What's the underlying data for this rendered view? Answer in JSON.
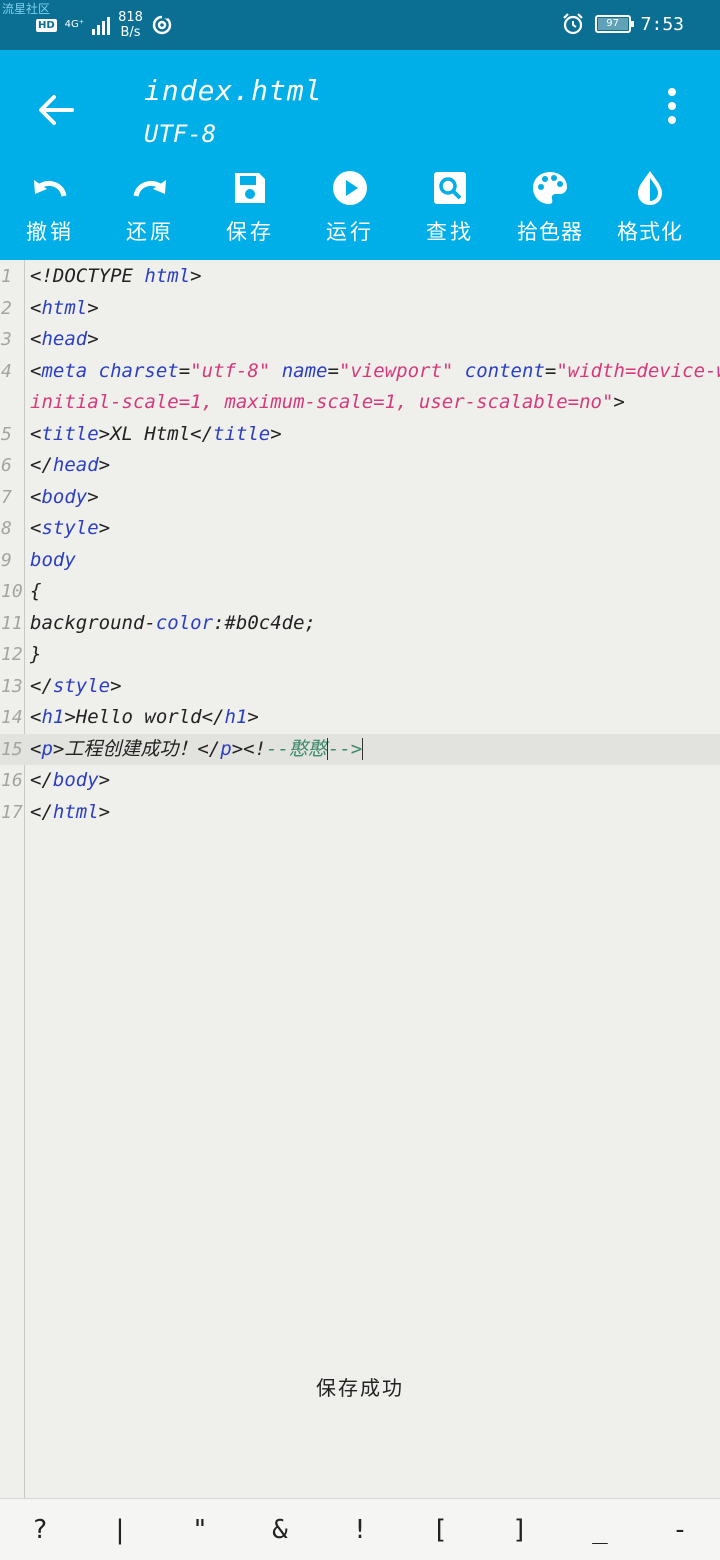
{
  "status_bar": {
    "watermark": "流星社区",
    "hd": "HD",
    "network": "4G⁺",
    "speed_value": "818",
    "speed_unit": "B/s",
    "battery": "97",
    "time": "7:53",
    "icons": [
      "hd-icon",
      "signal-icon",
      "nfc-icon",
      "alarm-icon",
      "battery-icon"
    ]
  },
  "app_bar": {
    "title": "index.html",
    "encoding": "UTF-8",
    "accent_color": "#00aee8"
  },
  "toolbar": {
    "undo": "撤销",
    "redo": "还原",
    "save": "保存",
    "run": "运行",
    "find": "查找",
    "color_picker": "拾色器",
    "format": "格式化"
  },
  "editor": {
    "lines": [
      {
        "n": "1",
        "parts": [
          "<!DOCTYPE ",
          "html",
          ">"
        ]
      },
      {
        "n": "2",
        "parts": [
          "<",
          "html",
          ">"
        ]
      },
      {
        "n": "3",
        "parts": [
          "<",
          "head",
          ">"
        ]
      },
      {
        "n": "4",
        "parts": [
          "<",
          "meta",
          " ",
          "charset",
          "=",
          "\"utf-8\"",
          " ",
          "name",
          "=",
          "\"viewport\"",
          " ",
          "content",
          "=",
          "\"width=device-width,"
        ]
      },
      {
        "n": "",
        "parts": [
          "initial-scale=1, maximum-scale=1, user-scalable=no\"",
          ">"
        ]
      },
      {
        "n": "5",
        "parts": [
          "<",
          "title",
          ">XL Html</",
          "title",
          ">"
        ]
      },
      {
        "n": "6",
        "parts": [
          "</",
          "head",
          ">"
        ]
      },
      {
        "n": "7",
        "parts": [
          "<",
          "body",
          ">"
        ]
      },
      {
        "n": "8",
        "parts": [
          "<",
          "style",
          ">"
        ]
      },
      {
        "n": "9",
        "parts": [
          "body"
        ]
      },
      {
        "n": "10",
        "parts": [
          "{"
        ]
      },
      {
        "n": "11",
        "parts": [
          "    background-",
          "color",
          ":#b0c4de;"
        ]
      },
      {
        "n": "12",
        "parts": [
          "}"
        ]
      },
      {
        "n": "13",
        "parts": [
          "</",
          "style",
          ">"
        ]
      },
      {
        "n": "14",
        "parts": [
          "<",
          "h1",
          ">Hello world</",
          "h1",
          ">"
        ]
      },
      {
        "n": "15",
        "parts": [
          "<",
          "p",
          ">工程创建成功！</",
          "p",
          "><!",
          "--憨憨",
          "-->"
        ]
      },
      {
        "n": "16",
        "parts": [
          "</",
          "body",
          ">"
        ]
      },
      {
        "n": "17",
        "parts": [
          "</",
          "html",
          ">"
        ]
      }
    ]
  },
  "toast": "保存成功",
  "symbols": [
    "?",
    "|",
    "\"",
    "&",
    "!",
    "[",
    "]",
    "_",
    "-"
  ]
}
